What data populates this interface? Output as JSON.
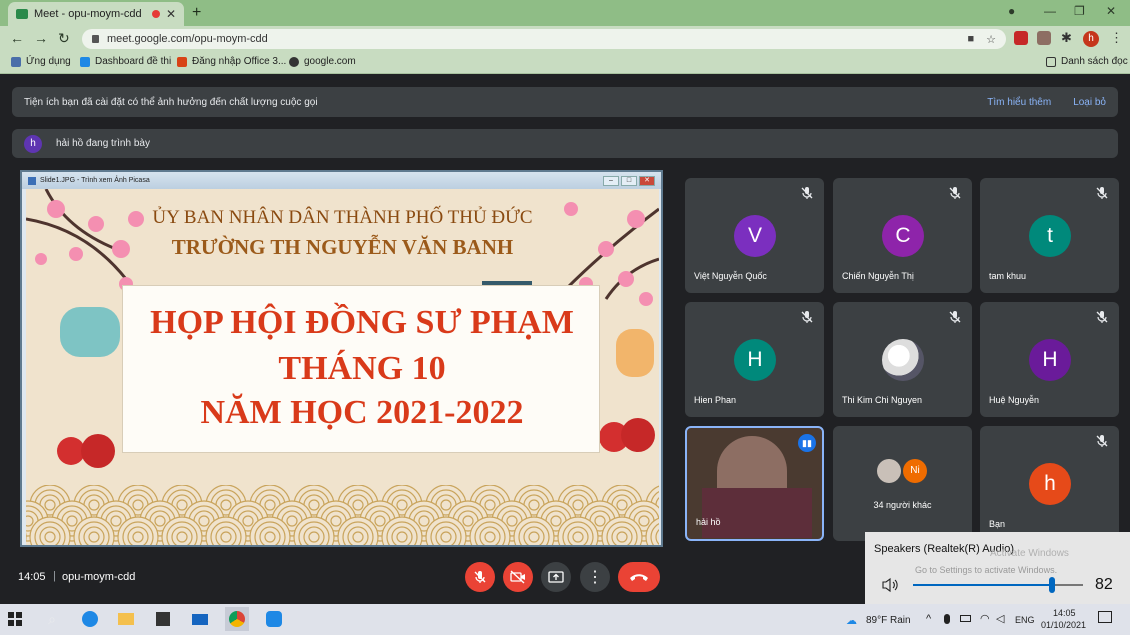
{
  "browser": {
    "tab_title": "Meet - opu-moym-cdd",
    "new_tab": "+",
    "url": "meet.google.com/opu-moym-cdd",
    "profile_initial": "h",
    "bookmarks": [
      {
        "label": "Ứng dụng",
        "icon": "apps-grid-icon"
      },
      {
        "label": "Dashboard đề thi",
        "icon": "google-drive-icon"
      },
      {
        "label": "Đăng nhập Office 3...",
        "icon": "office-icon"
      },
      {
        "label": "google.com",
        "icon": "globe-icon"
      }
    ],
    "reading_list": "Danh sách đọc"
  },
  "notice": {
    "text": "Tiện ích bạn đã cài đặt có thể ảnh hưởng đến chất lượng cuộc gọi",
    "learn_more": "Tìm hiểu thêm",
    "remove": "Loại bỏ"
  },
  "presenting": {
    "initial": "h",
    "text": "hải hồ đang trình bày"
  },
  "presentation": {
    "window_title": "Slide1.JPG - Trình xem Ảnh Picasa",
    "line1": "ỦY BAN NHÂN DÂN THÀNH PHỐ THỦ ĐỨC",
    "line2": "TRƯỜNG TH NGUYỄN VĂN BANH",
    "title1": "HỌP HỘI ĐỒNG SƯ PHẠM",
    "title2": "THÁNG 10",
    "title3": "NĂM HỌC 2021-2022"
  },
  "participants": [
    {
      "initial": "V",
      "name": "Việt Nguyễn Quốc",
      "color": "#7b2fbf",
      "muted": true
    },
    {
      "initial": "C",
      "name": "Chiến Nguyễn Thị",
      "color": "#8e24aa",
      "muted": true
    },
    {
      "initial": "t",
      "name": "tam khuu",
      "color": "#00897b",
      "muted": true
    },
    {
      "initial": "H",
      "name": "Hien Phan",
      "color": "#00897b",
      "muted": true
    },
    {
      "initial": "",
      "name": "Thi Kim Chi Nguyen",
      "color": "#c9c9c9",
      "muted": true
    },
    {
      "initial": "H",
      "name": "Huệ Nguyễn",
      "color": "#6a1b9a",
      "muted": true
    },
    {
      "initial": "",
      "name": "hải hồ",
      "color": "#4a3a30",
      "muted": false
    },
    {
      "initial": "Ni",
      "name": "34 người khác",
      "color": "#ef6c00",
      "muted": false
    },
    {
      "initial": "h",
      "name": "Bạn",
      "color": "#e64a19",
      "muted": true
    }
  ],
  "meeting": {
    "time": "14:05",
    "separator": "|",
    "code": "opu-moym-cdd"
  },
  "speaker_popup": {
    "device": "Speakers (Realtek(R) Audio)",
    "volume": "82",
    "volume_level": 0.82,
    "watermark1": "Activate Windows",
    "watermark2": "Go to Settings to activate Windows."
  },
  "taskbar": {
    "weather": "89°F Rain",
    "language": "ENG",
    "time": "14:05",
    "date": "01/10/2021"
  }
}
